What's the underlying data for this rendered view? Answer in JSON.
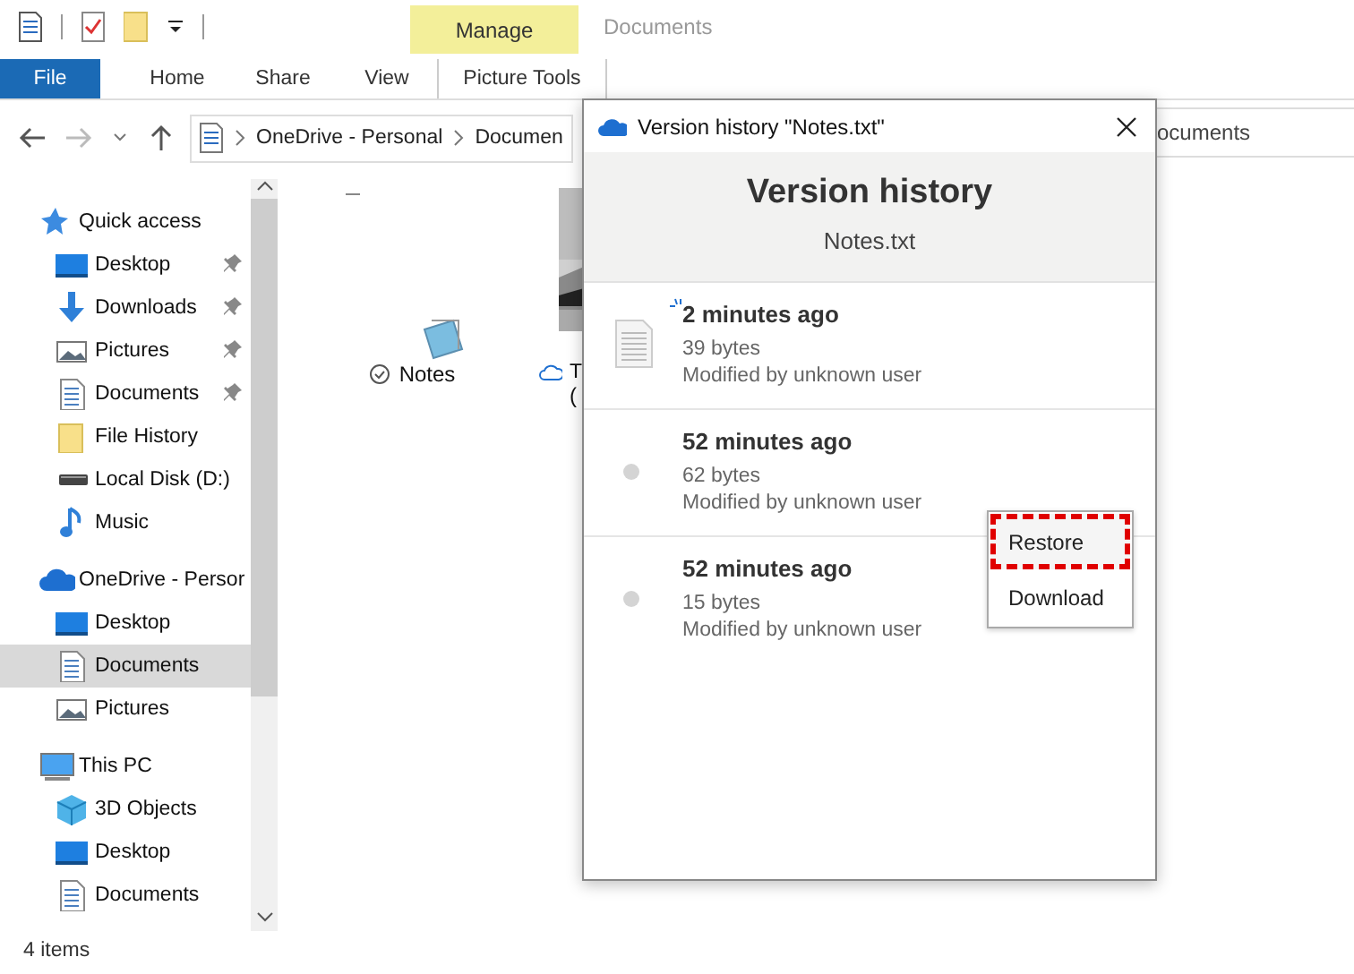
{
  "window": {
    "title": "Documents"
  },
  "ribbon": {
    "contextual_group": "Manage",
    "tabs": [
      {
        "label": "File",
        "kind": "file",
        "selected": false
      },
      {
        "label": "Home",
        "kind": "tab",
        "selected": false
      },
      {
        "label": "Share",
        "kind": "tab",
        "selected": false
      },
      {
        "label": "View",
        "kind": "tab",
        "selected": false
      },
      {
        "label": "Picture Tools",
        "kind": "contextual",
        "selected": false
      }
    ]
  },
  "address_bar": {
    "path": [
      "OneDrive - Personal",
      "Documen"
    ],
    "search_visible_text": "ocuments"
  },
  "sidebar": {
    "items": [
      {
        "label": "Quick access",
        "kind": "star",
        "selected": false,
        "children": [
          {
            "label": "Desktop",
            "kind": "desktop",
            "pinned": true,
            "selected": false
          },
          {
            "label": "Downloads",
            "kind": "download",
            "pinned": true,
            "selected": false
          },
          {
            "label": "Pictures",
            "kind": "pictures",
            "pinned": true,
            "selected": false
          },
          {
            "label": "Documents",
            "kind": "document",
            "pinned": true,
            "selected": false
          },
          {
            "label": "File History",
            "kind": "folder",
            "pinned": false,
            "selected": false
          },
          {
            "label": "Local Disk (D:)",
            "kind": "drive",
            "pinned": false,
            "selected": false
          },
          {
            "label": "Music",
            "kind": "music",
            "pinned": false,
            "selected": false
          }
        ]
      },
      {
        "label": "OneDrive - Persor",
        "kind": "cloud",
        "selected": false,
        "children": [
          {
            "label": "Desktop",
            "kind": "desktop",
            "pinned": false,
            "selected": false
          },
          {
            "label": "Documents",
            "kind": "document",
            "pinned": false,
            "selected": true
          },
          {
            "label": "Pictures",
            "kind": "pictures",
            "pinned": false,
            "selected": false
          }
        ]
      },
      {
        "label": "This PC",
        "kind": "pc",
        "selected": false,
        "children": [
          {
            "label": "3D Objects",
            "kind": "cube",
            "pinned": false,
            "selected": false
          },
          {
            "label": "Desktop",
            "kind": "desktop",
            "pinned": false,
            "selected": false
          },
          {
            "label": "Documents",
            "kind": "document",
            "pinned": false,
            "selected": false
          }
        ]
      }
    ]
  },
  "files": [
    {
      "label": "Notes",
      "kind": "note",
      "available_offline": true
    },
    {
      "label": "T",
      "label_line_2": "(",
      "kind": "picture",
      "available_offline": false
    }
  ],
  "status_bar": {
    "text": "4 items"
  },
  "dialog": {
    "title": "Version history \"Notes.txt\"",
    "heading": "Version history",
    "file_name": "Notes.txt",
    "versions": [
      {
        "time": "2 minutes ago",
        "size": "39 bytes",
        "author": "Modified by unknown user",
        "current": true
      },
      {
        "time": "52 minutes ago",
        "size": "62 bytes",
        "author": "Modified by unknown user",
        "current": false
      },
      {
        "time": "52 minutes ago",
        "size": "15 bytes",
        "author": "Modified by unknown user",
        "current": false
      }
    ],
    "context_menu": [
      {
        "label": "Restore",
        "selected": true
      },
      {
        "label": "Download",
        "selected": false
      }
    ]
  }
}
